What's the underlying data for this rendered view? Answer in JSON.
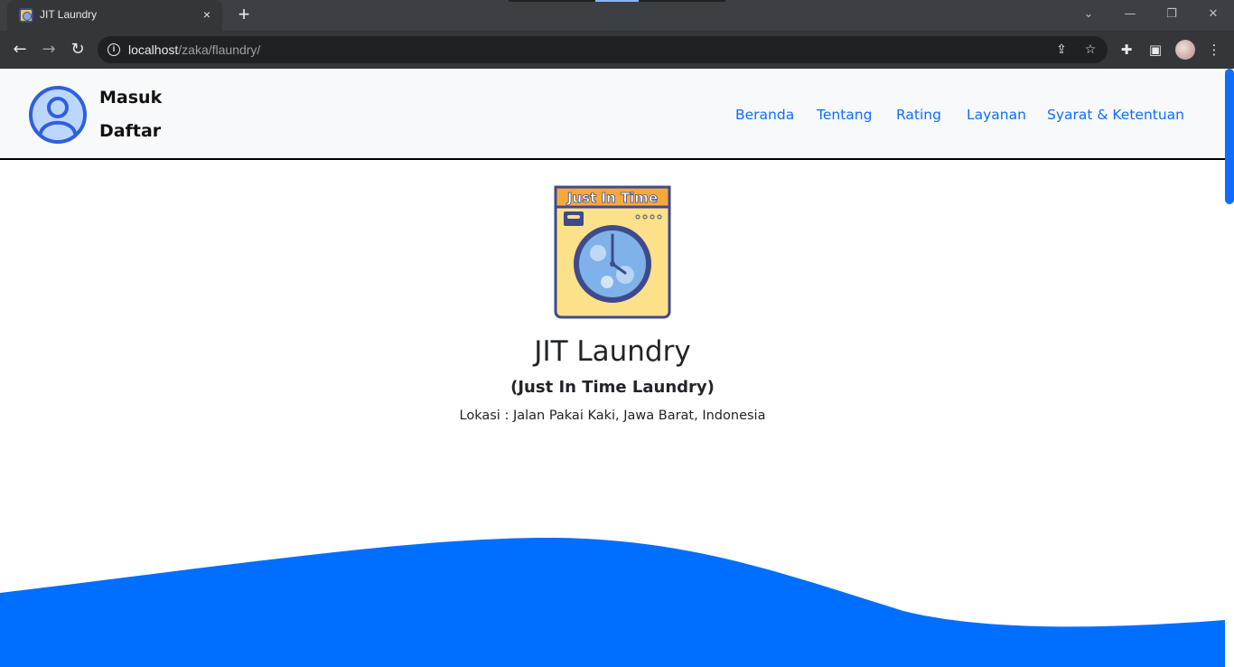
{
  "browser": {
    "tab_title": "JIT Laundry",
    "tab_close": "×",
    "new_tab": "+",
    "url_host": "localhost",
    "url_path": "/zaka/flaundry/",
    "icons": {
      "back": "back-arrow-icon",
      "forward": "forward-arrow-icon",
      "reload": "reload-icon",
      "info": "info-icon",
      "share": "share-icon",
      "bookmark": "star-icon",
      "extensions": "puzzle-icon",
      "side_panel": "side-panel-icon",
      "menu": "kebab-menu-icon"
    }
  },
  "navbar": {
    "login_label": "Masuk",
    "register_label": "Daftar",
    "menu": [
      {
        "label": "Beranda"
      },
      {
        "label": "Tentang"
      },
      {
        "label": "Rating"
      },
      {
        "label": "Layanan"
      },
      {
        "label": "Syarat & Ketentuan"
      }
    ]
  },
  "hero": {
    "logo_text": "Just In Time",
    "title": "JIT Laundry",
    "subtitle": "(Just In Time Laundry)",
    "location": "Lokasi : Jalan Pakai Kaki, Jawa Barat, Indonesia"
  },
  "colors": {
    "accent": "#0d6efd",
    "wave": "#006eff",
    "navbar_bg": "#f8f9fa",
    "chrome_dark": "#35363a"
  }
}
